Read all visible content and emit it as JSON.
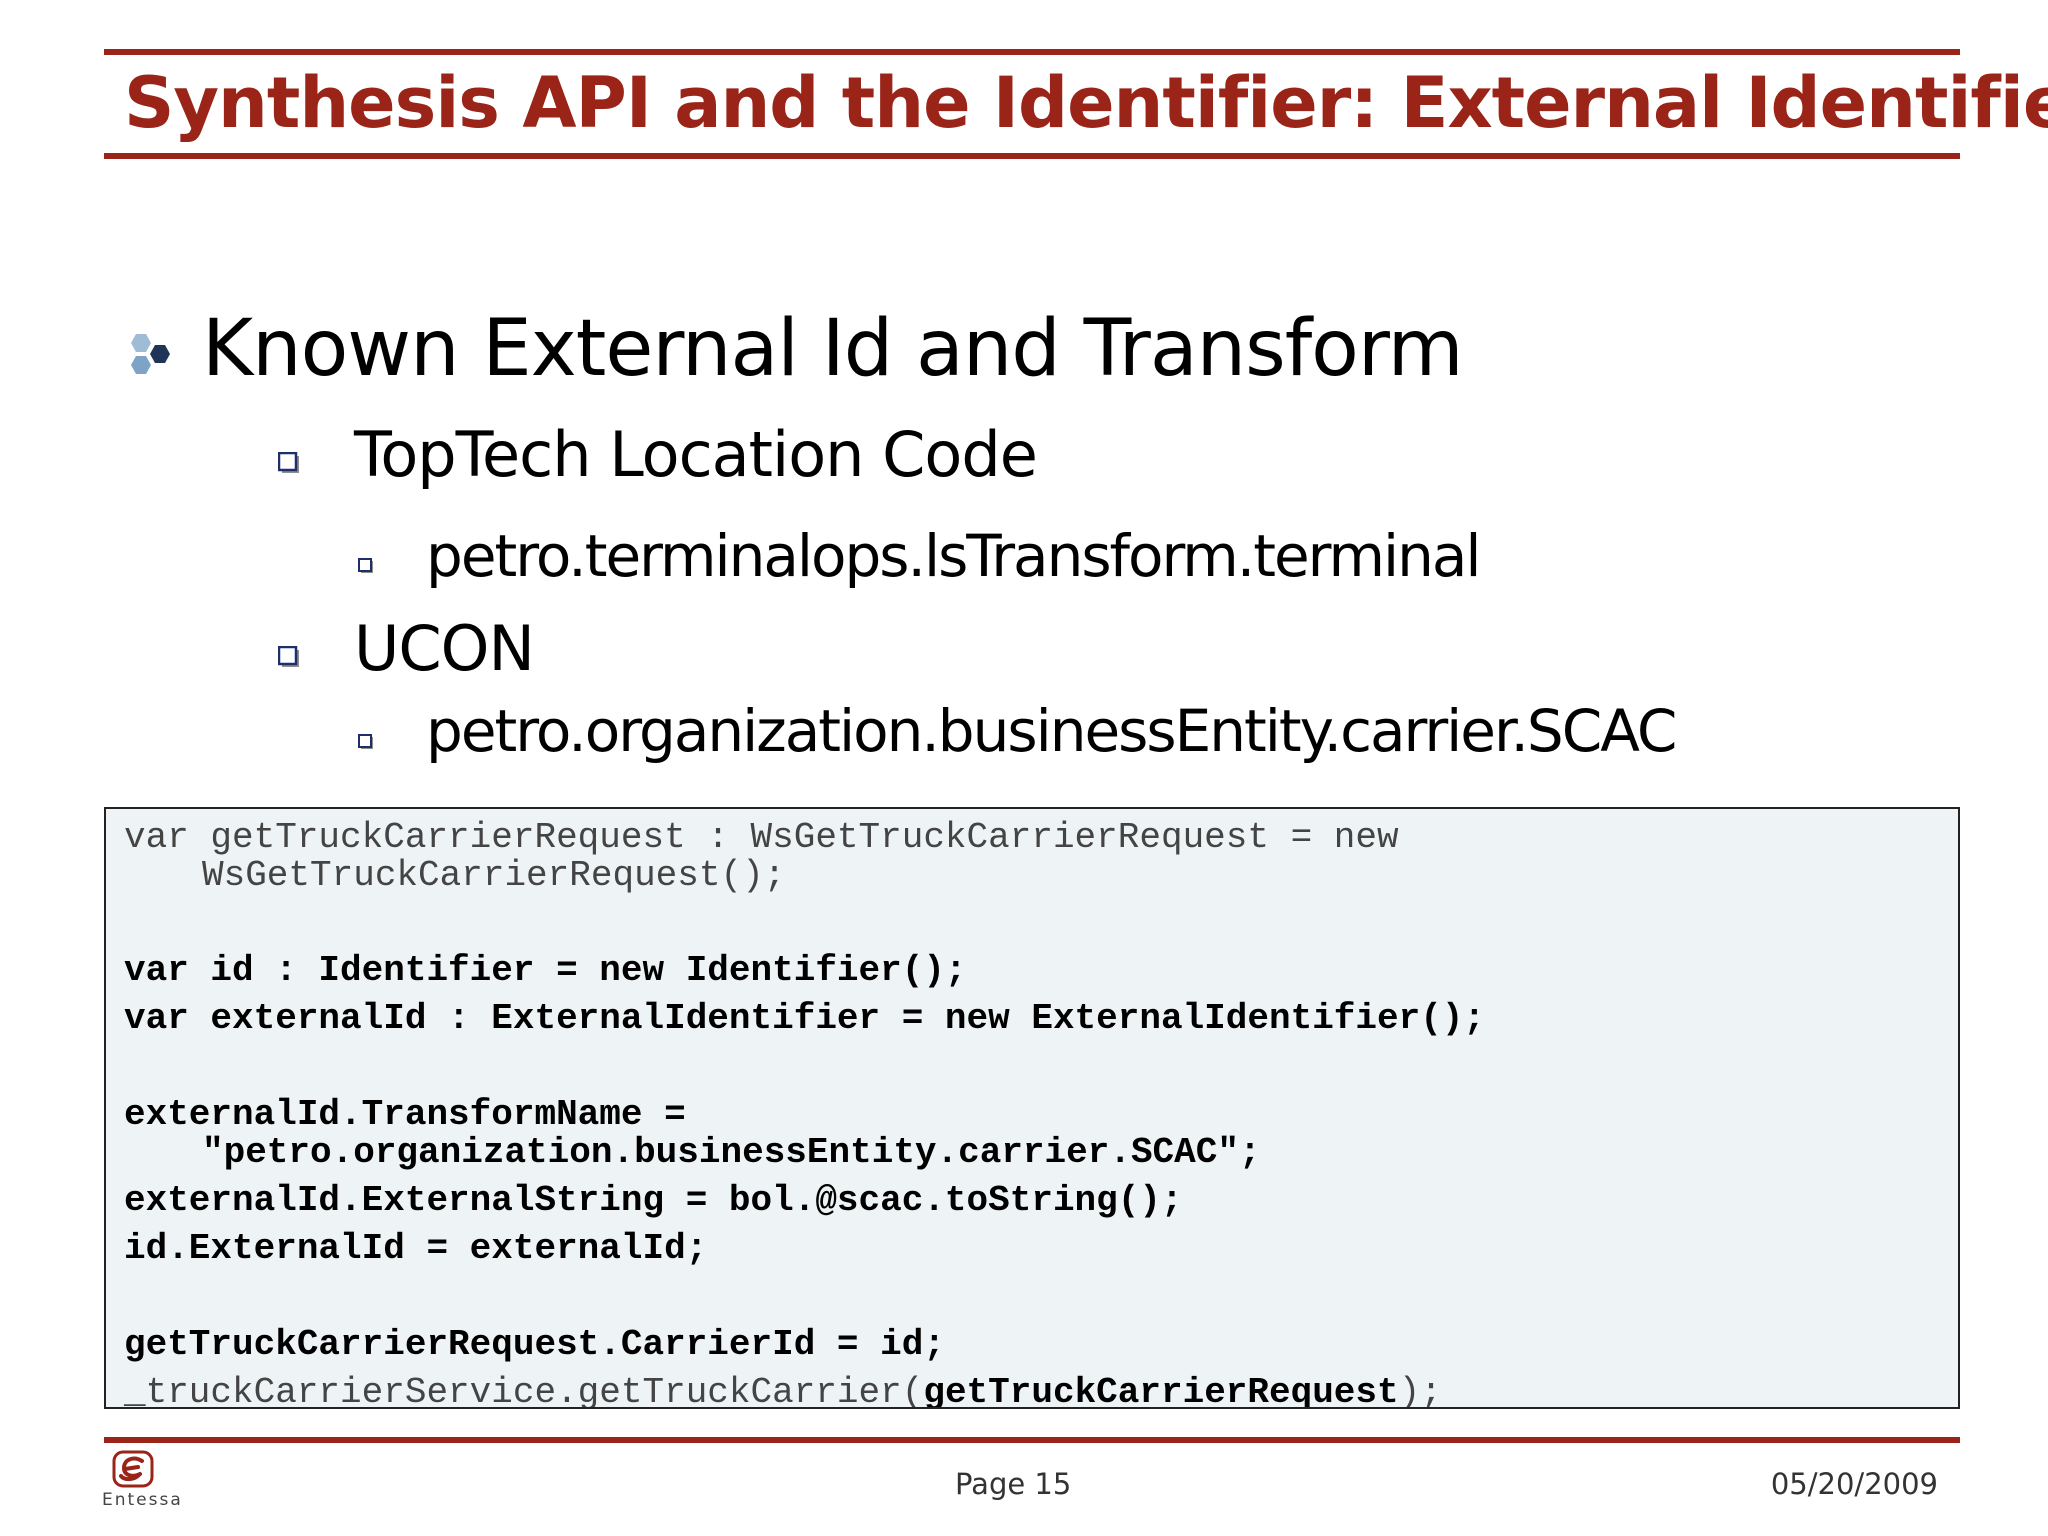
{
  "title": "Synthesis API and the Identifier: External Identifier",
  "colors": {
    "accent": "#9a2418",
    "code_background": "#eef4f5",
    "bullet_square": "#1f2f6e",
    "hex_dark": "#1f3457",
    "hex_light": "#8fb0cc"
  },
  "outline": {
    "bullet_icon": "hexagon-cluster-icon",
    "heading": "Known External Id and Transform",
    "items": [
      {
        "label": "TopTech Location Code",
        "sub": "petro.terminalops.lsTransform.terminal"
      },
      {
        "label": "UCON",
        "sub": "petro.organization.businessEntity.carrier.SCAC"
      }
    ]
  },
  "code": {
    "lines": [
      "var getTruckCarrierRequest : WsGetTruckCarrierRequest = new",
      "WsGetTruckCarrierRequest();",
      "var id : Identifier = new Identifier();",
      "var externalId : ExternalIdentifier = new ExternalIdentifier();",
      "externalId.TransformName =",
      "\"petro.organization.businessEntity.carrier.SCAC\";",
      "externalId.ExternalString = bol.@scac.toString();",
      "id.ExternalId = externalId;",
      "getTruckCarrierRequest.CarrierId = id;",
      "_truckCarrierService.getTruckCarrier(",
      "getTruckCarrierRequest",
      ");"
    ]
  },
  "footer": {
    "brand": "Entessa",
    "page": "Page 15",
    "date": "05/20/2009"
  }
}
